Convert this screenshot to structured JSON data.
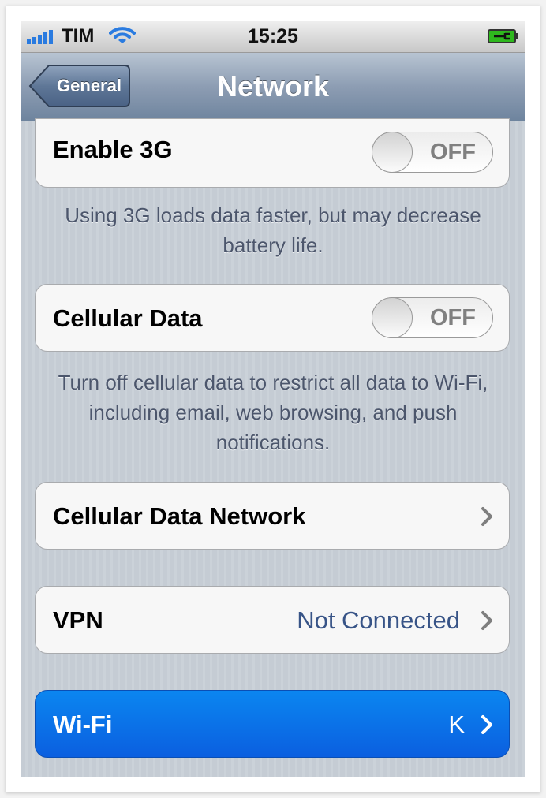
{
  "status_bar": {
    "carrier": "TIM",
    "time": "15:25",
    "signal_icon": "signal-bars-icon",
    "wifi_icon": "wifi-icon",
    "battery_icon": "battery-charging-icon",
    "battery_color": "#2fb81e"
  },
  "nav_bar": {
    "back_label": "General",
    "title": "Network"
  },
  "settings": {
    "enable_3g": {
      "label": "Enable 3G",
      "toggle": "OFF"
    },
    "enable_3g_footnote": "Using 3G loads data faster, but may decrease battery life.",
    "cellular_data": {
      "label": "Cellular Data",
      "toggle": "OFF"
    },
    "cellular_data_footnote": "Turn off cellular data to restrict all data to Wi-Fi, including email, web browsing, and push notifications.",
    "cellular_data_network": {
      "label": "Cellular Data Network"
    },
    "vpn": {
      "label": "VPN",
      "value": "Not Connected"
    },
    "wifi": {
      "label": "Wi-Fi",
      "value": "K"
    }
  },
  "colors": {
    "detail_text": "#385487",
    "selected_row": "#0b6fe8",
    "background": "#c5ccd4"
  }
}
